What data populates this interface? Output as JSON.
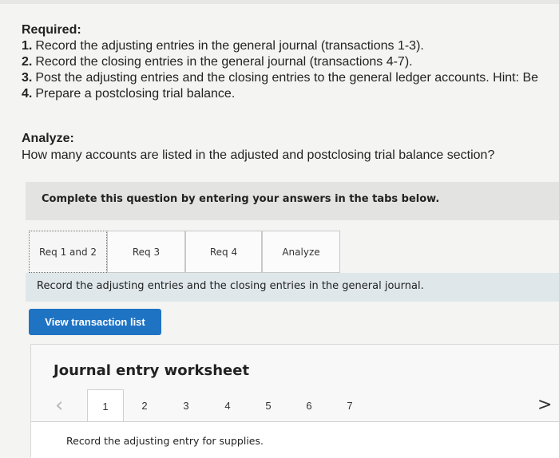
{
  "required": {
    "title": "Required:",
    "items": [
      {
        "num": "1.",
        "text": "Record the adjusting entries in the general journal (transactions 1-3)."
      },
      {
        "num": "2.",
        "text": "Record the closing entries in the general journal (transactions 4-7)."
      },
      {
        "num": "3.",
        "text": "Post the adjusting entries and the closing entries to the general ledger accounts. Hint: Be"
      },
      {
        "num": "4.",
        "text": "Prepare a postclosing trial balance."
      }
    ]
  },
  "analyze": {
    "title": "Analyze:",
    "question": "How many accounts are listed in the adjusted and postclosing trial balance section?"
  },
  "instructions": {
    "complete": "Complete this question by entering your answers in the tabs below."
  },
  "tabs": [
    "Req 1 and 2",
    "Req 3",
    "Req 4",
    "Analyze"
  ],
  "tab_instruction": "Record the adjusting entries and the closing entries in the general journal.",
  "view_transactions_label": "View transaction list",
  "worksheet": {
    "title": "Journal entry worksheet",
    "pages": [
      "1",
      "2",
      "3",
      "4",
      "5",
      "6",
      "7"
    ],
    "prev_icon": "chevron-left-icon",
    "next_icon": "chevron-right-icon",
    "entry_instruction": "Record the adjusting entry for supplies."
  },
  "colors": {
    "button": "#1f73c3",
    "instruction_bar": "#dfe7ea",
    "header_bar": "#e3e3e2"
  }
}
